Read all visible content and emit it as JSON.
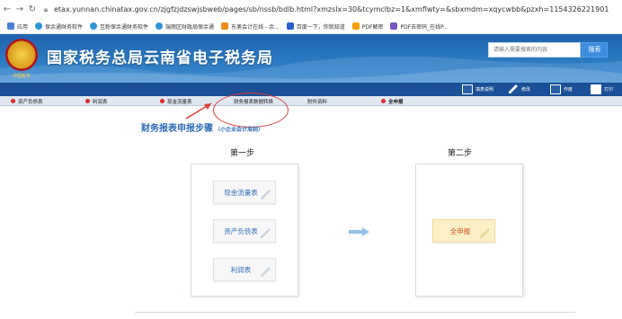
{
  "browser": {
    "url": "etax.yunnan.chinatax.gov.cn/zjgfzjdzswjsbweb/pages/sb/nssb/bdlb.html?xmzslx=30&tcymclbz=1&xmflwty=&sbxmdm=xqycwbb&pzxh=1154326221901",
    "bookmarks": [
      "应用",
      "保余通财务软件",
      "互粉保余通财务软件",
      "瑞丽区财政局保余通",
      "东奥会计在线 - 余...",
      "百度一下，你就知道",
      "PDF解密",
      "PDF去密码_在线P..."
    ],
    "bookmark_colors": [
      "#4a7fd6",
      "#2f95d8",
      "#2f95d8",
      "#2f95d8",
      "#f28a1c",
      "#2b5fd3",
      "#f2a100",
      "#7a56c2"
    ]
  },
  "header": {
    "site_title": "国家税务总局云南省电子税务局",
    "emblem_caption": "中国税务",
    "search_placeholder": "请输入需要搜索的内容",
    "search_button": "搜索"
  },
  "toolbar": {
    "items": [
      "填表说明",
      "修改",
      "作废",
      "打印"
    ]
  },
  "tabs": {
    "items": [
      {
        "label": "资产负债表",
        "marker": true
      },
      {
        "label": "利润表",
        "marker": true
      },
      {
        "label": "现金流量表",
        "marker": true
      },
      {
        "label": "财务报表数据转换",
        "marker": false
      },
      {
        "label": "附件资料",
        "marker": false
      },
      {
        "label": "全申报",
        "marker": true
      }
    ]
  },
  "steps": {
    "title": "财务报表申报步骤",
    "subtitle": "（小企业会计准则）",
    "step1_label": "第一步",
    "step2_label": "第二步",
    "step1_buttons": [
      "现金流量表",
      "资产负债表",
      "利润表"
    ],
    "step2_button": "全申报"
  },
  "colors": {
    "brand_blue": "#1e63ae",
    "annotation_red": "#e23b3b",
    "accent_blue": "#2d6cb8"
  }
}
